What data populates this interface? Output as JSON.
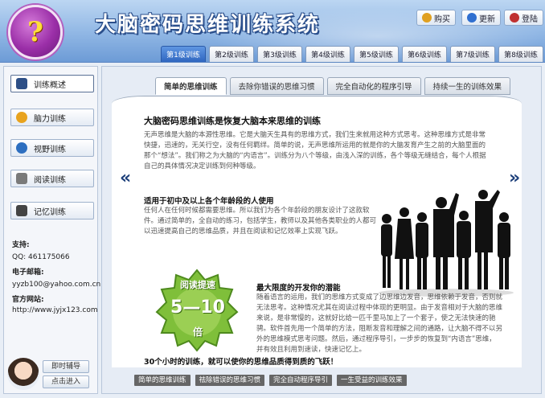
{
  "header": {
    "logo_glyph": "?",
    "title": "大脑密码思维训练系统",
    "buttons": [
      {
        "label": "购买",
        "icon": "cart-icon",
        "color": "#e0a020"
      },
      {
        "label": "更新",
        "icon": "refresh-icon",
        "color": "#2f6fd0"
      },
      {
        "label": "登陆",
        "icon": "login-icon",
        "color": "#c03030"
      }
    ],
    "levels": [
      "第1级训练",
      "第2级训练",
      "第3级训练",
      "第4级训练",
      "第5级训练",
      "第6级训练",
      "第7级训练",
      "第8级训练"
    ],
    "active_level": 0
  },
  "sidebar": {
    "items": [
      {
        "label": "训练概述",
        "icon": "id-card-icon",
        "active": true
      },
      {
        "label": "脑力训练",
        "icon": "brain-icon",
        "active": false
      },
      {
        "label": "视野训练",
        "icon": "eye-icon",
        "active": false
      },
      {
        "label": "阅读训练",
        "icon": "book-icon",
        "active": false
      },
      {
        "label": "记忆训练",
        "icon": "memory-icon",
        "active": false
      }
    ],
    "support_label": "支持:",
    "qq": "QQ: 461175066",
    "email_label": "电子邮箱:",
    "email": "yyzb100@yahoo.com.cn",
    "site_label": "官方网站:",
    "site": "http://www.jyjx123.com",
    "assist_top": "即时辅导",
    "assist_bottom": "点击进入"
  },
  "main": {
    "tabs": [
      "简单的思维训练",
      "去除你错误的思维习惯",
      "完全自动化的程序引导",
      "持续一生的训练效果"
    ],
    "active_tab": 0,
    "heading": "大脑密码思维训练是恢复大脑本来思维的训练",
    "para1": "无声思维是大脑的本源性思维。它是大脑天生具有的思维方式，我们生来就用这种方式思考。这种思维方式是非常快捷，迅速的，无关行空，没有任何羁绊。简单的说，无声思维所运用的就是你的大脑发育产生之前的大脑里面的那个“想法”。我们称之为大脑的“内语言”。训练分为八个等级，由浅入深的训练，各个等级无缝结合，每个人根据自己的具体情况决定训练到何种等级。",
    "sub1": "适用于初中及以上各个年龄段的人使用",
    "para2": "任何人在任何时候都需要思维。所以我们为各个年龄段的朋友设计了这款软件。通过简单的，全自动的练习，包括学生，教师以及其他各类职业的人都可以迅速提高自己的思维品质，并且在阅读和记忆效率上实现飞跃。",
    "sub2": "最大限度的开发你的潜能",
    "para3": "随着语言的运用，我们的思维方式变成了边思维边发音，思维依赖于发音，否则就无法思考。这种情况尤其在阅读过程中体现的更明显。由于发音相对于大脑的思维来说，是非常慢的，这就好比给一匹千里马加上了一个套子，使之无法快速的驰骋。软件首先用一个简单的方法，阻断发音和理解之间的通路，让大脑不得不以另外的思维模式思考问题。然后，通过程序导引，一步步的恢复到“内语言”思维，并有效且利用到速读，快速记忆上。",
    "tagline": "30个小时的训练，就可以使你的思维品质得到质的飞跃！",
    "badge_top": "阅读提速",
    "badge_main": "5—10",
    "badge_bottom": "倍",
    "bottom_tabs": [
      "简单的思维训练",
      "祛除错误的思维习惯",
      "完全自动程序导引",
      "一生受益的训练效果"
    ],
    "prev_arrow": "«",
    "next_arrow": "»"
  }
}
